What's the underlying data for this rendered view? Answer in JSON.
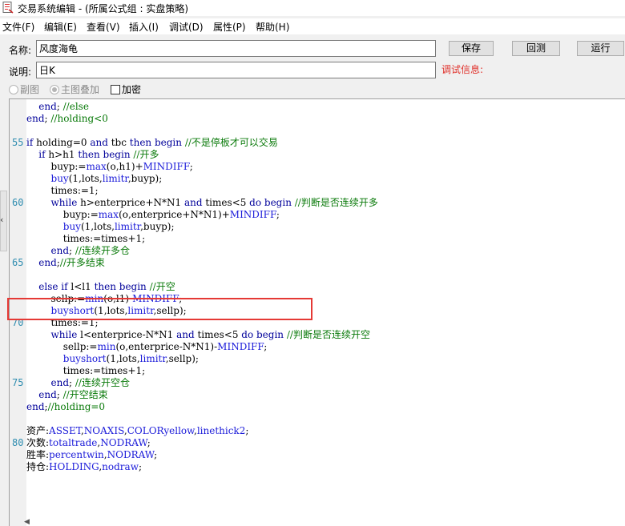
{
  "window": {
    "title": "交易系统编辑 - (所属公式组 : 实盘策略)",
    "icon": "document-icon"
  },
  "menu": [
    "文件(F)",
    "编辑(E)",
    "查看(V)",
    "插入(I)",
    "调试(D)",
    "属性(P)",
    "帮助(H)"
  ],
  "form": {
    "name_label": "名称:",
    "name_value": "风度海龟",
    "desc_label": "说明:",
    "desc_value": "日K",
    "save_button": "保存",
    "test_button": "回测",
    "run_button": "运行",
    "debug_label": "调试信息:"
  },
  "options": {
    "subchart": "副图",
    "overlay": "主图叠加",
    "encrypt": "加密"
  },
  "editor": {
    "line_numbers": [
      "55",
      "60",
      "65",
      "70",
      "75",
      "80"
    ],
    "lines": [
      [
        {
          "c": "kw",
          "t": "    end"
        },
        {
          "c": "tx",
          "t": "; "
        },
        {
          "c": "cm",
          "t": "//else"
        }
      ],
      [
        {
          "c": "kw",
          "t": "end"
        },
        {
          "c": "tx",
          "t": "; "
        },
        {
          "c": "cm",
          "t": "//holding<0"
        }
      ],
      [],
      [
        {
          "c": "kw",
          "t": "if"
        },
        {
          "c": "tx",
          "t": " holding=0 "
        },
        {
          "c": "kw",
          "t": "and"
        },
        {
          "c": "tx",
          "t": " tbc "
        },
        {
          "c": "kw",
          "t": "then begin"
        },
        {
          "c": "tx",
          "t": " "
        },
        {
          "c": "cm",
          "t": "//不是停板才可以交易"
        }
      ],
      [
        {
          "c": "kw",
          "t": "    if"
        },
        {
          "c": "tx",
          "t": " h>h1 "
        },
        {
          "c": "kw",
          "t": "then begin"
        },
        {
          "c": "tx",
          "t": " "
        },
        {
          "c": "cm",
          "t": "//开多"
        }
      ],
      [
        {
          "c": "tx",
          "t": "        buyp:="
        },
        {
          "c": "fn",
          "t": "max"
        },
        {
          "c": "tx",
          "t": "(o,h1)+"
        },
        {
          "c": "cn",
          "t": "MINDIFF"
        },
        {
          "c": "tx",
          "t": ";"
        }
      ],
      [
        {
          "c": "fn",
          "t": "        buy"
        },
        {
          "c": "tx",
          "t": "(1,lots,"
        },
        {
          "c": "fn",
          "t": "limitr"
        },
        {
          "c": "tx",
          "t": ",buyp);"
        }
      ],
      [
        {
          "c": "tx",
          "t": "        times:=1;"
        }
      ],
      [
        {
          "c": "kw",
          "t": "        while"
        },
        {
          "c": "tx",
          "t": " h>enterprice+N*N1 "
        },
        {
          "c": "kw",
          "t": "and"
        },
        {
          "c": "tx",
          "t": " times<5 "
        },
        {
          "c": "kw",
          "t": "do begin"
        },
        {
          "c": "tx",
          "t": " "
        },
        {
          "c": "cm",
          "t": "//判断是否连续开多"
        }
      ],
      [
        {
          "c": "tx",
          "t": "            buyp:="
        },
        {
          "c": "fn",
          "t": "max"
        },
        {
          "c": "tx",
          "t": "(o,enterprice+N*N1)+"
        },
        {
          "c": "cn",
          "t": "MINDIFF"
        },
        {
          "c": "tx",
          "t": ";"
        }
      ],
      [
        {
          "c": "fn",
          "t": "            buy"
        },
        {
          "c": "tx",
          "t": "(1,lots,"
        },
        {
          "c": "fn",
          "t": "limitr"
        },
        {
          "c": "tx",
          "t": ",buyp);"
        }
      ],
      [
        {
          "c": "tx",
          "t": "            times:=times+1;"
        }
      ],
      [
        {
          "c": "kw",
          "t": "        end"
        },
        {
          "c": "tx",
          "t": "; "
        },
        {
          "c": "cm",
          "t": "//连续开多仓"
        }
      ],
      [
        {
          "c": "kw",
          "t": "    end"
        },
        {
          "c": "tx",
          "t": ";"
        },
        {
          "c": "cm",
          "t": "//开多结束"
        }
      ],
      [],
      [
        {
          "c": "kw",
          "t": "    else if"
        },
        {
          "c": "tx",
          "t": " l<l1 "
        },
        {
          "c": "kw",
          "t": "then begin"
        },
        {
          "c": "tx",
          "t": " "
        },
        {
          "c": "cm",
          "t": "//开空"
        }
      ],
      [
        {
          "c": "tx",
          "t": "        sellp:="
        },
        {
          "c": "fn",
          "t": "min"
        },
        {
          "c": "tx",
          "t": "(o,l1)-"
        },
        {
          "c": "cn",
          "t": "MINDIFF"
        },
        {
          "c": "tx",
          "t": ";"
        }
      ],
      [
        {
          "c": "fn",
          "t": "        buyshort"
        },
        {
          "c": "tx",
          "t": "(1,lots,"
        },
        {
          "c": "fn",
          "t": "limitr"
        },
        {
          "c": "tx",
          "t": ",sellp);"
        }
      ],
      [
        {
          "c": "tx",
          "t": "        times:=1;"
        }
      ],
      [
        {
          "c": "kw",
          "t": "        while"
        },
        {
          "c": "tx",
          "t": " l<enterprice-N*N1 "
        },
        {
          "c": "kw",
          "t": "and"
        },
        {
          "c": "tx",
          "t": " times<5 "
        },
        {
          "c": "kw",
          "t": "do begin"
        },
        {
          "c": "tx",
          "t": " "
        },
        {
          "c": "cm",
          "t": "//判断是否连续开空"
        }
      ],
      [
        {
          "c": "tx",
          "t": "            sellp:="
        },
        {
          "c": "fn",
          "t": "min"
        },
        {
          "c": "tx",
          "t": "(o,enterprice-N*N1)-"
        },
        {
          "c": "cn",
          "t": "MINDIFF"
        },
        {
          "c": "tx",
          "t": ";"
        }
      ],
      [
        {
          "c": "fn",
          "t": "            buyshort"
        },
        {
          "c": "tx",
          "t": "(1,lots,"
        },
        {
          "c": "fn",
          "t": "limitr"
        },
        {
          "c": "tx",
          "t": ",sellp);"
        }
      ],
      [
        {
          "c": "tx",
          "t": "            times:=times+1;"
        }
      ],
      [
        {
          "c": "kw",
          "t": "        end"
        },
        {
          "c": "tx",
          "t": "; "
        },
        {
          "c": "cm",
          "t": "//连续开空仓"
        }
      ],
      [
        {
          "c": "kw",
          "t": "    end"
        },
        {
          "c": "tx",
          "t": "; "
        },
        {
          "c": "cm",
          "t": "//开空结束"
        }
      ],
      [
        {
          "c": "kw",
          "t": "end"
        },
        {
          "c": "tx",
          "t": ";"
        },
        {
          "c": "cm",
          "t": "//holding=0"
        }
      ],
      [],
      [
        {
          "c": "tx",
          "t": "资产:"
        },
        {
          "c": "cn",
          "t": "ASSET"
        },
        {
          "c": "tx",
          "t": ","
        },
        {
          "c": "cn",
          "t": "NOAXIS"
        },
        {
          "c": "tx",
          "t": ","
        },
        {
          "c": "cn",
          "t": "COLORyellow"
        },
        {
          "c": "tx",
          "t": ","
        },
        {
          "c": "cn",
          "t": "linethick2"
        },
        {
          "c": "tx",
          "t": ";"
        }
      ],
      [
        {
          "c": "tx",
          "t": "次数:"
        },
        {
          "c": "cn",
          "t": "totaltrade"
        },
        {
          "c": "tx",
          "t": ","
        },
        {
          "c": "cn",
          "t": "NODRAW"
        },
        {
          "c": "tx",
          "t": ";"
        }
      ],
      [
        {
          "c": "tx",
          "t": "胜率:"
        },
        {
          "c": "cn",
          "t": "percentwin"
        },
        {
          "c": "tx",
          "t": ","
        },
        {
          "c": "cn",
          "t": "NODRAW"
        },
        {
          "c": "tx",
          "t": ";"
        }
      ],
      [
        {
          "c": "tx",
          "t": "持仓:"
        },
        {
          "c": "cn",
          "t": "HOLDING"
        },
        {
          "c": "tx",
          "t": ","
        },
        {
          "c": "cn",
          "t": "nodraw"
        },
        {
          "c": "tx",
          "t": ";"
        }
      ]
    ]
  },
  "colors": {
    "keyword": "#00009a",
    "function": "#1b1bd9",
    "comment": "#0a7a0a",
    "line_number": "#2f8db0",
    "debug_label": "#e0302a",
    "highlight_box": "#e53935"
  }
}
